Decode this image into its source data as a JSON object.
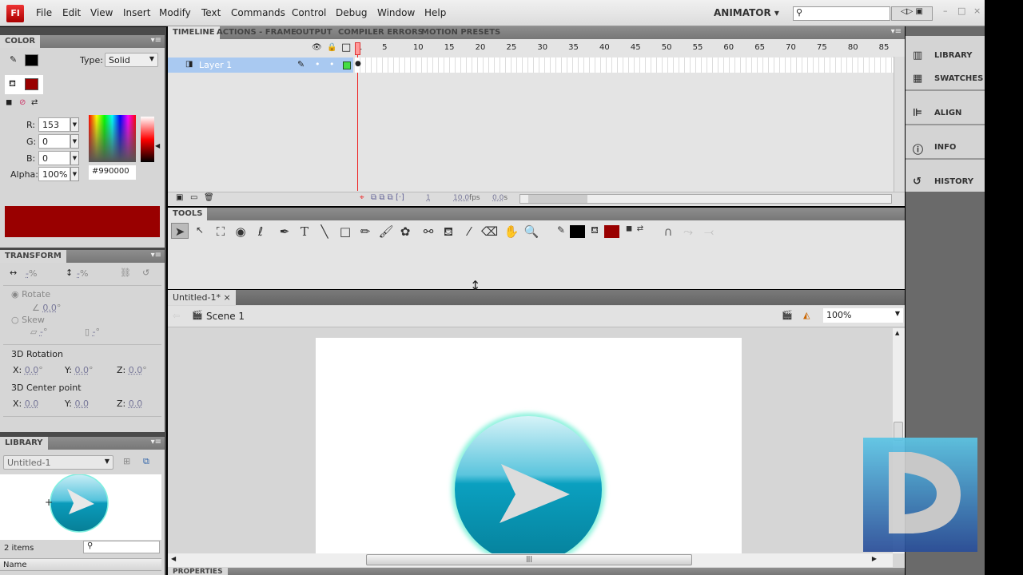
{
  "menubar": {
    "logo": "Fl",
    "items": [
      "File",
      "Edit",
      "View",
      "Insert",
      "Modify",
      "Text",
      "Commands",
      "Control",
      "Debug",
      "Window",
      "Help"
    ],
    "workspace": "ANIMATOR",
    "search_placeholder": ""
  },
  "color_panel": {
    "title": "COLOR",
    "type_label": "Type:",
    "type_value": "Solid",
    "r_label": "R:",
    "r": "153",
    "g_label": "G:",
    "g": "0",
    "b_label": "B:",
    "b": "0",
    "alpha_label": "Alpha:",
    "alpha": "100%",
    "hex": "#990000",
    "stroke_color": "#000000",
    "fill_color": "#990000"
  },
  "transform_panel": {
    "title": "TRANSFORM",
    "width_val": "-",
    "height_val": "-",
    "pct": "%",
    "rotate_label": "Rotate",
    "rotate_val": "0.0",
    "skew_label": "Skew",
    "skew_h": "-",
    "skew_v": "-",
    "deg": "°",
    "rot3d_label": "3D Rotation",
    "rx": "0.0",
    "ry": "0.0",
    "rz": "0.0",
    "center_label": "3D Center point",
    "cx": "0.0",
    "cy": "0.0",
    "cz": "0.0",
    "x_label": "X:",
    "y_label": "Y:",
    "z_label": "Z:"
  },
  "library_panel": {
    "title": "LIBRARY",
    "document": "Untitled-1",
    "items_count": "2 items",
    "name_header": "Name"
  },
  "timeline": {
    "tabs": [
      "TIMELINE",
      "ACTIONS - FRAME",
      "OUTPUT",
      "COMPILER ERRORS",
      "MOTION PRESETS"
    ],
    "frame_numbers": [
      "1",
      "5",
      "10",
      "15",
      "20",
      "25",
      "30",
      "35",
      "40",
      "45",
      "50",
      "55",
      "60",
      "65",
      "70",
      "75",
      "80",
      "85"
    ],
    "layer_name": "Layer 1",
    "current_frame": "1",
    "fps": "10.0",
    "fps_unit": "fps",
    "time": "0.0",
    "time_unit": "s"
  },
  "tools": {
    "title": "TOOLS"
  },
  "document": {
    "tab": "Untitled-1*",
    "close": "×",
    "scene": "Scene 1",
    "zoom": "100%"
  },
  "properties": {
    "title": "PROPERTIES"
  },
  "right_panel": {
    "items": [
      "LIBRARY",
      "SWATCHES",
      "ALIGN",
      "INFO",
      "HISTORY"
    ]
  },
  "colors": {
    "accent": "#990000",
    "layer_highlight": "#a9c9f1",
    "button_teal": "#0a9bbb"
  }
}
